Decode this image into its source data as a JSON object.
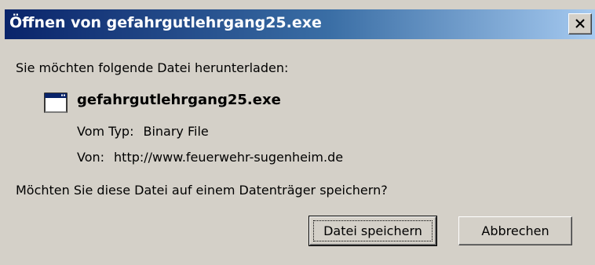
{
  "window": {
    "title": "Öffnen von gefahrgutlehrgang25.exe",
    "close_icon": "close-icon"
  },
  "dialog": {
    "prompt": "Sie möchten folgende Datei herunterladen:",
    "file_icon": "application-window-icon",
    "file_name": "gefahrgutlehrgang25.exe",
    "type_label": "Vom Typ:",
    "type_value": "Binary File",
    "from_label": "Von:",
    "from_value": "http://www.feuerwehr-sugenheim.de",
    "question": "Möchten Sie diese Datei auf einem Datenträger speichern?"
  },
  "buttons": {
    "save_label": "Datei speichern",
    "cancel_label": "Abbrechen"
  },
  "colors": {
    "titlebar_start": "#0a246a",
    "titlebar_end": "#a6caf0",
    "dialog_bg": "#d4d0c8"
  }
}
